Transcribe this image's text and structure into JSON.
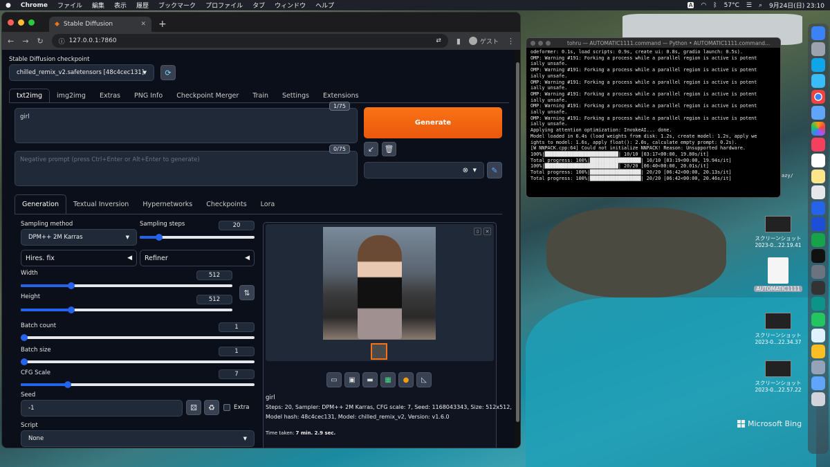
{
  "menubar": {
    "app": "Chrome",
    "items": [
      "ファイル",
      "編集",
      "表示",
      "履歴",
      "ブックマーク",
      "プロファイル",
      "タブ",
      "ウィンドウ",
      "ヘルプ"
    ],
    "temp": "57°C",
    "datetime": "9月24日(日) 23:10",
    "input_icon": "A"
  },
  "browser": {
    "tab_title": "Stable Diffusion",
    "url": "127.0.0.1:7860",
    "profile": "ゲスト"
  },
  "checkpoint": {
    "label": "Stable Diffusion checkpoint",
    "value": "chilled_remix_v2.safetensors [48c4cec131]"
  },
  "main_tabs": [
    "txt2img",
    "img2img",
    "Extras",
    "PNG Info",
    "Checkpoint Merger",
    "Train",
    "Settings",
    "Extensions"
  ],
  "prompt": {
    "value": "girl",
    "counter": "1/75"
  },
  "negative": {
    "placeholder": "Negative prompt (press Ctrl+Enter or Alt+Enter to generate)",
    "counter": "0/75"
  },
  "generate_label": "Generate",
  "sub_tabs": [
    "Generation",
    "Textual Inversion",
    "Hypernetworks",
    "Checkpoints",
    "Lora"
  ],
  "gen": {
    "sampling_method_label": "Sampling method",
    "sampling_method": "DPM++ 2M Karras",
    "sampling_steps_label": "Sampling steps",
    "sampling_steps": "20",
    "hires": "Hires. fix",
    "refiner": "Refiner",
    "width_label": "Width",
    "width": "512",
    "height_label": "Height",
    "height": "512",
    "batch_count_label": "Batch count",
    "batch_count": "1",
    "batch_size_label": "Batch size",
    "batch_size": "1",
    "cfg_label": "CFG Scale",
    "cfg": "7",
    "seed_label": "Seed",
    "seed": "-1",
    "extra": "Extra",
    "script_label": "Script",
    "script": "None"
  },
  "sliders": {
    "steps": 0.17,
    "width": 0.24,
    "height": 0.24,
    "batch_count": 0.0,
    "batch_size": 0.0,
    "cfg": 0.2
  },
  "output": {
    "prompt": "girl",
    "params": "Steps: 20, Sampler: DPM++ 2M Karras, CFG scale: 7, Seed: 1168043343, Size: 512x512,",
    "params2": "Model hash: 48c4cec131, Model: chilled_remix_v2, Version: v1.6.0",
    "time_label": "Time taken:",
    "time_value": "7 min. 2.9 sec."
  },
  "terminal": {
    "title": "tohru — AUTOMATIC1111.command — Python • AUTOMATIC1111.command...",
    "lines": [
      "odeformer: 0.1s, load scripts: 0.9s, create ui: 0.8s, gradio launch: 0.5s).",
      "OMP: Warning #191: Forking a process while a parallel region is active is potent",
      "ially unsafe.",
      "OMP: Warning #191: Forking a process while a parallel region is active is potent",
      "ially unsafe.",
      "OMP: Warning #191: Forking a process while a parallel region is active is potent",
      "ially unsafe.",
      "OMP: Warning #191: Forking a process while a parallel region is active is potent",
      "ially unsafe.",
      "OMP: Warning #191: Forking a process while a parallel region is active is potent",
      "ially unsafe.",
      "OMP: Warning #191: Forking a process while a parallel region is active is potent",
      "ially unsafe.",
      "Applying attention optimization: InvokeAI... done.",
      "Model loaded in 6.4s (load weights from disk: 1.2s, create model: 1.2s, apply we",
      "ights to model: 1.6s, apply float(): 2.0s, calculate empty prompt: 0.2s).",
      "[W NNPACK.cpp:64] Could not initialize NNPACK! Reason: Unsupported hardware.",
      "100%|██████████████████████████| 10/10 [03:17<00:00, 19.80s/it]",
      "Total progress: 100%|██████████████████| 10/10 [03:19<00:00, 19.94s/it]",
      "100%|██████████████████████████| 20/20 [06:40<00:00, 20.01s/it]",
      "Total progress: 100%|██████████████████| 20/20 [06:42<00:00, 20.13s/it]",
      "Total progress: 100%|██████████████████| 20/20 [06:42<00:00, 20.46s/it]"
    ]
  },
  "desktop": {
    "icons": [
      {
        "label1": "スクリーンショット",
        "label2": "2023-0...22.19.41"
      },
      {
        "label1": "AUTOMATIC1111",
        "label2": ""
      },
      {
        "label1": "スクリーンショット",
        "label2": "2023-0...22.34.37"
      },
      {
        "label1": "スクリーンショット",
        "label2": "2023-0...22.57.22"
      }
    ],
    "bing": "Microsoft Bing",
    "side_text": "azy/"
  }
}
